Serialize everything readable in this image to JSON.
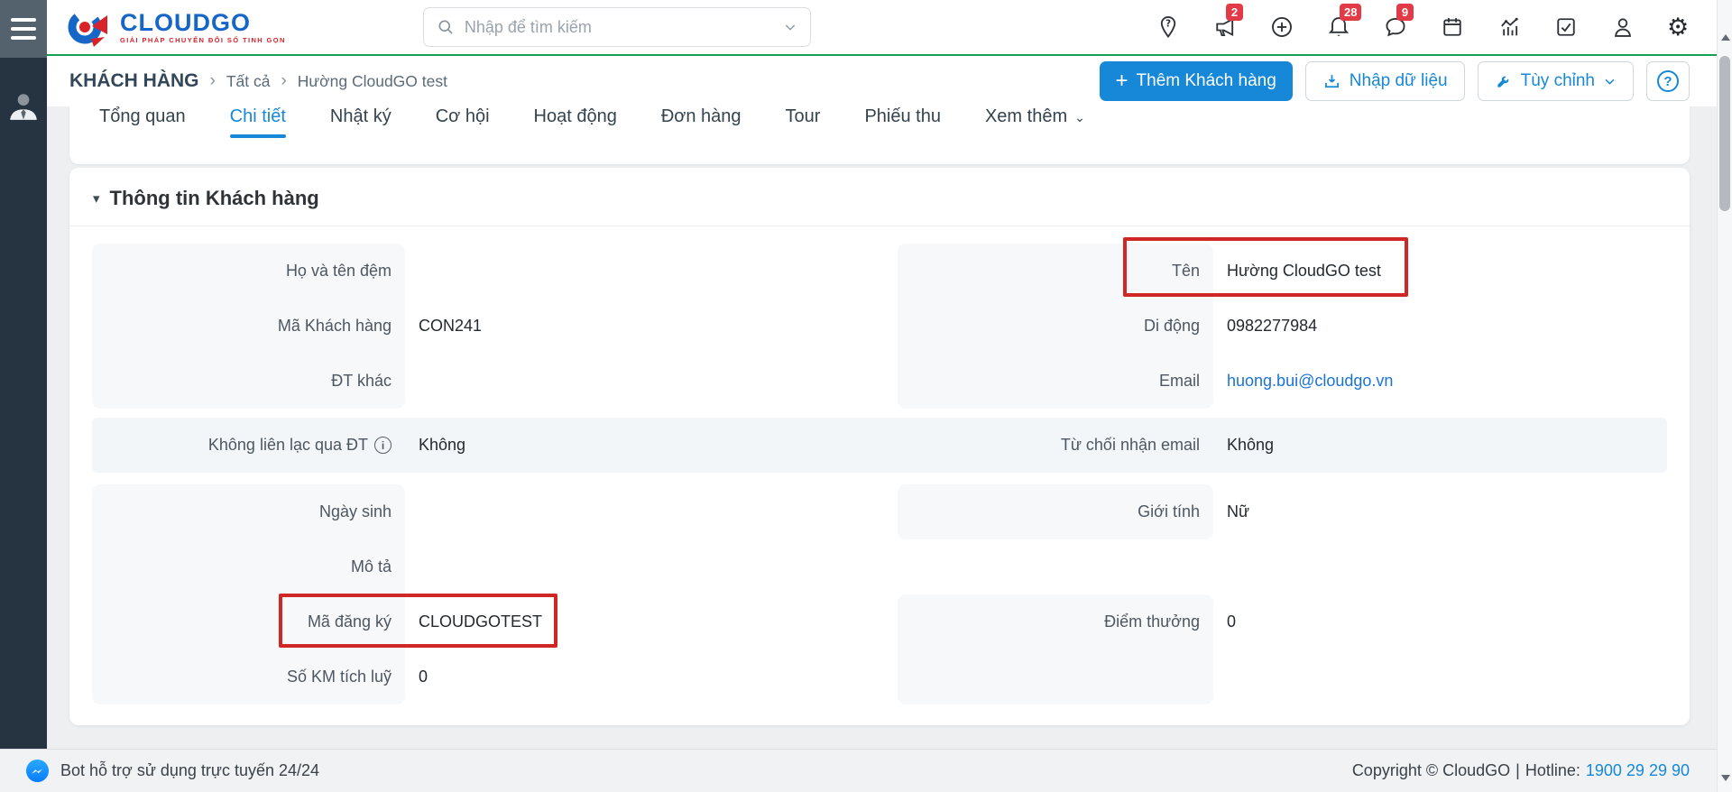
{
  "app": {
    "name": "CLOUDGO",
    "tagline": "GIẢI PHÁP CHUYỂN ĐỔI SỐ TINH GỌN"
  },
  "header": {
    "search_placeholder": "Nhập để tìm kiếm",
    "badges": {
      "announcements": "2",
      "notifications": "28",
      "messages": "9"
    }
  },
  "breadcrumb": {
    "module": "KHÁCH HÀNG",
    "sep": "›",
    "item1": "Tất cả",
    "item2": "Hường CloudGO test"
  },
  "actions": {
    "add": "Thêm Khách hàng",
    "add_plus": "+",
    "import": "Nhập dữ liệu",
    "customize": "Tùy chỉnh",
    "help": "?"
  },
  "tabs": {
    "items": [
      "Tổng quan",
      "Chi tiết",
      "Nhật ký",
      "Cơ hội",
      "Hoạt động",
      "Đơn hàng",
      "Tour",
      "Phiếu thu"
    ],
    "more": "Xem thêm",
    "active": "Chi tiết"
  },
  "section": {
    "collapse_caret": "▾",
    "title": "Thông tin Khách hàng"
  },
  "fields": {
    "ho_va_ten_dem": {
      "label": "Họ và tên đệm",
      "value": ""
    },
    "ten": {
      "label": "Tên",
      "value": "Hường CloudGO test"
    },
    "ma_khach_hang": {
      "label": "Mã Khách hàng",
      "value": "CON241"
    },
    "di_dong": {
      "label": "Di động",
      "value": "0982277984"
    },
    "dt_khac": {
      "label": "ĐT khác",
      "value": ""
    },
    "email": {
      "label": "Email",
      "value": "huong.bui@cloudgo.vn"
    },
    "khong_lien_lac": {
      "label": "Không liên lạc qua ĐT",
      "info": "i",
      "value": "Không"
    },
    "tu_choi_email": {
      "label": "Từ chối nhận email",
      "value": "Không"
    },
    "ngay_sinh": {
      "label": "Ngày sinh",
      "value": ""
    },
    "gioi_tinh": {
      "label": "Giới tính",
      "value": "Nữ"
    },
    "mo_ta": {
      "label": "Mô tả",
      "value": ""
    },
    "ma_dang_ky": {
      "label": "Mã đăng ký",
      "value": "CLOUDGOTEST"
    },
    "diem_thuong": {
      "label": "Điểm thưởng",
      "value": "0"
    },
    "so_km": {
      "label": "Số KM tích luỹ",
      "value": "0"
    }
  },
  "footer": {
    "bot": "Bot hỗ trợ sử dụng trực tuyến 24/24",
    "copyright": "Copyright © CloudGO",
    "divider": "|",
    "hotline_label": "Hotline:",
    "hotline": "1900 29 29 90"
  },
  "colors": {
    "accent_blue": "#1788d8",
    "header_green": "#15a053",
    "badge_red": "#e23b47",
    "annotation_red": "#cf2626"
  }
}
